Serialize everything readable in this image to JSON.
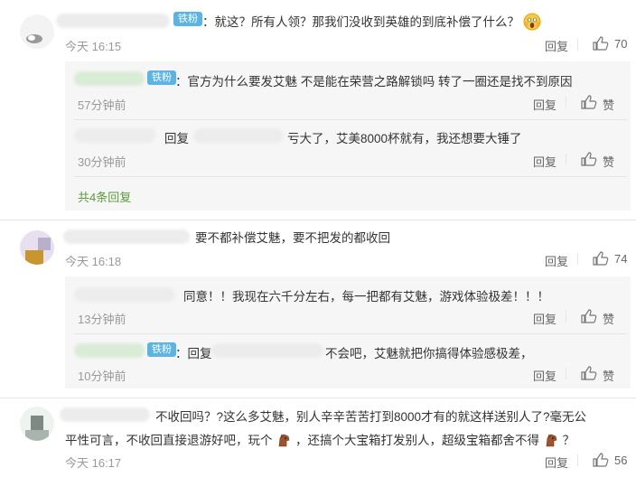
{
  "comments": [
    {
      "badge": "铁粉",
      "text": "：就这？所有人领？那我们没收到英雄的到底补偿了什么？",
      "time": "今天 16:15",
      "reply_label": "回复",
      "likes": "70",
      "emoji": "scream-emoji",
      "replies": [
        {
          "badge": "铁粉",
          "text": "：官方为什么要发艾魅 不是能在荣营之路解锁吗 转了一圈还是找不到原因",
          "time": "57分钟前",
          "reply_label": "回复",
          "like_label": "赞"
        },
        {
          "prefix": "回复",
          "text": "亏大了，艾美8000杯就有，我还想要大锤了",
          "time": "30分钟前",
          "reply_label": "回复",
          "like_label": "赞"
        }
      ],
      "more": "共4条回复"
    },
    {
      "text": "要不都补偿艾魅，要不把发的都收回",
      "time": "今天 16:18",
      "reply_label": "回复",
      "likes": "74",
      "replies": [
        {
          "text": "同意！！我现在六千分左右，每一把都有艾魅，游戏体验极差！！！",
          "time": "13分钟前",
          "reply_label": "回复",
          "like_label": "赞"
        },
        {
          "badge": "铁粉",
          "prefix": "：回复",
          "text": "不会吧，艾魅就把你搞得体验感极差，",
          "time": "10分钟前",
          "reply_label": "回复",
          "like_label": "赞"
        }
      ]
    },
    {
      "text_line1": "不收回吗？?这么多艾魅，别人辛辛苦苦打到8000才有的就这样送别人了?毫无公",
      "text_line2a": "平性可言，不收回直接退游好吧，玩个",
      "text_line2b": "，还搞个大宝箱打发别人，超级宝箱都舍不得",
      "text_line2c": "？",
      "time": "今天 16:17",
      "reply_label": "回复",
      "likes": "56"
    }
  ]
}
